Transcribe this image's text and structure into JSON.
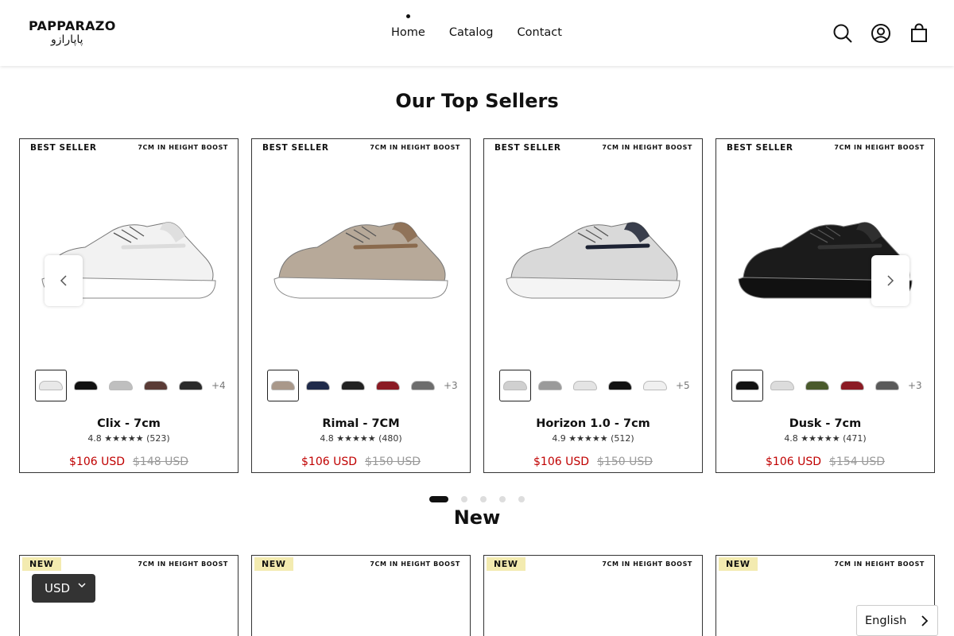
{
  "header": {
    "logo_latin": "PAPPARAZO",
    "logo_persian": "پاپارازو",
    "nav": [
      "Home",
      "Catalog",
      "Contact"
    ],
    "icons": [
      "search-icon",
      "account-icon",
      "cart-icon"
    ]
  },
  "top_sellers": {
    "title": "Our Top Sellers",
    "products": [
      {
        "badge": "BEST SELLER",
        "boost": "7CM IN HEIGHT BOOST",
        "name": "Clix - 7cm",
        "rating": "4.8 ★★★★★ (523)",
        "price": "$106 USD",
        "compare_price": "$148 USD",
        "more": "+4",
        "shoe_colors": {
          "upper": "#f2f2f2",
          "sole": "#ffffff",
          "accent": "#dcdcdc"
        },
        "swatches": [
          "#e8e8e8",
          "#111111",
          "#bfbfbf",
          "#5a3b36",
          "#2a2a2a"
        ]
      },
      {
        "badge": "BEST SELLER",
        "boost": "7CM IN HEIGHT BOOST",
        "name": "Rimal - 7CM",
        "rating": "4.8 ★★★★★ (480)",
        "price": "$106 USD",
        "compare_price": "$150 USD",
        "more": "+3",
        "shoe_colors": {
          "upper": "#b7a999",
          "sole": "#ffffff",
          "accent": "#8a6a4d"
        },
        "swatches": [
          "#a9988a",
          "#1f2a4a",
          "#222222",
          "#8b1b24",
          "#6d6d6d"
        ]
      },
      {
        "badge": "BEST SELLER",
        "boost": "7CM IN HEIGHT BOOST",
        "name": "Horizon 1.0 - 7cm",
        "rating": "4.9 ★★★★★ (512)",
        "price": "$106 USD",
        "compare_price": "$150 USD",
        "more": "+5",
        "shoe_colors": {
          "upper": "#d9d9d9",
          "sole": "#f4f4f4",
          "accent": "#1c2233"
        },
        "swatches": [
          "#d0d0d0",
          "#9a9a9a",
          "#e4e4e4",
          "#111111",
          "#f0f0f0"
        ]
      },
      {
        "badge": "BEST SELLER",
        "boost": "7CM IN HEIGHT BOOST",
        "name": "Dusk - 7cm",
        "rating": "4.8 ★★★★★ (471)",
        "price": "$106 USD",
        "compare_price": "$154 USD",
        "more": "+3",
        "shoe_colors": {
          "upper": "#1b1b1b",
          "sole": "#111111",
          "accent": "#333333"
        },
        "swatches": [
          "#111111",
          "#dcdcdc",
          "#4a5a2c",
          "#8b1b24",
          "#5a5a5a"
        ]
      }
    ]
  },
  "pagination": {
    "count": 5,
    "active": 0
  },
  "new_section": {
    "title": "New",
    "cards": [
      {
        "badge": "NEW",
        "boost": "7CM IN HEIGHT BOOST"
      },
      {
        "badge": "NEW",
        "boost": "7CM IN HEIGHT BOOST"
      },
      {
        "badge": "NEW",
        "boost": "7CM IN HEIGHT BOOST"
      },
      {
        "badge": "NEW",
        "boost": "7CM IN HEIGHT BOOST"
      }
    ]
  },
  "currency_selector": {
    "value": "USD"
  },
  "language_selector": {
    "value": "English"
  },
  "colors": {
    "price": "#c00000",
    "new_badge_bg": "#f3ebb0",
    "currency_bg": "#333333"
  }
}
